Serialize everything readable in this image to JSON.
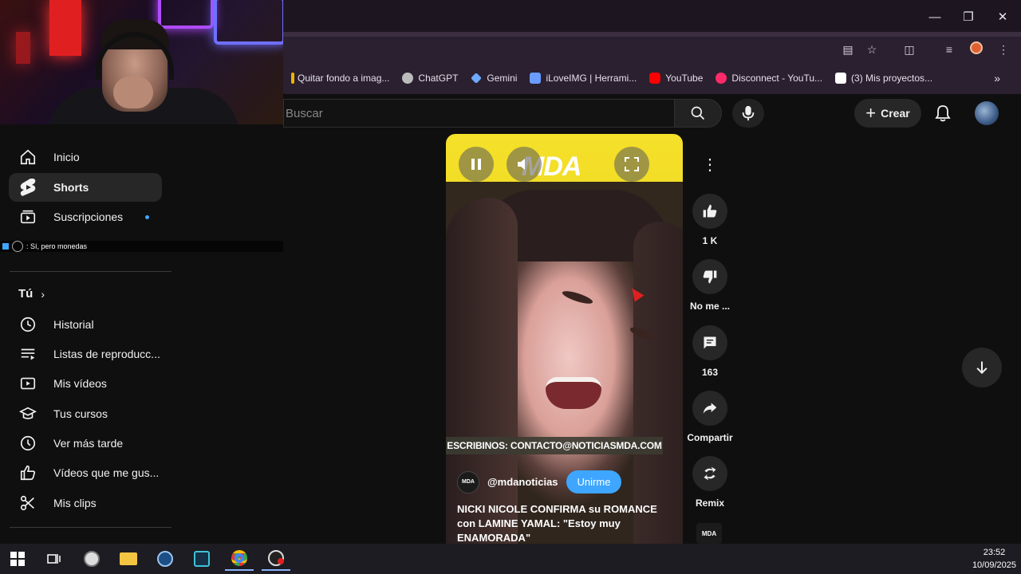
{
  "browser": {
    "bookmarks": [
      {
        "label": "Quitar fondo a imag...",
        "color": "#f0b400"
      },
      {
        "label": "ChatGPT",
        "color": "#bbbbbb"
      },
      {
        "label": "Gemini",
        "color": "#6fa8ff"
      },
      {
        "label": "iLoveIMG | Herrami...",
        "color": "#6a9cff"
      },
      {
        "label": "YouTube",
        "color": "#ff0000"
      },
      {
        "label": "Disconnect - YouTu...",
        "color": "#ff2a6a"
      },
      {
        "label": "(3)  Mis proyectos...",
        "color": "#ffffff"
      }
    ]
  },
  "header": {
    "search_placeholder": "Buscar",
    "create_label": "Crear"
  },
  "chat_overlay": {
    "text": ": Sí, pero monedas"
  },
  "sidebar": {
    "top": [
      {
        "label": "Inicio",
        "icon": "home-icon"
      },
      {
        "label": "Shorts",
        "icon": "shorts-icon",
        "active": true
      },
      {
        "label": "Suscripciones",
        "icon": "subscriptions-icon",
        "dot": true
      }
    ],
    "you_label": "Tú",
    "you_items": [
      {
        "label": "Historial",
        "icon": "history-icon"
      },
      {
        "label": "Listas de reproducc...",
        "icon": "playlists-icon"
      },
      {
        "label": "Mis vídeos",
        "icon": "my-videos-icon"
      },
      {
        "label": "Tus cursos",
        "icon": "courses-icon"
      },
      {
        "label": "Ver más tarde",
        "icon": "watch-later-icon"
      },
      {
        "label": "Vídeos que me gus...",
        "icon": "liked-icon"
      },
      {
        "label": "Mis clips",
        "icon": "clips-icon"
      }
    ]
  },
  "short": {
    "brand_watermark": "MDA",
    "banner_text": "ESCRIBINOS: CONTACTO@NOTICIASMDA.COM",
    "channel_name": "@mdanoticias",
    "channel_logo_text": "MDA",
    "join_label": "Unirme",
    "caption": "NICKI NICOLE CONFIRMA su ROMANCE con LAMINE YAMAL: \"Estoy muy ENAMORADA\""
  },
  "actions": {
    "like_count": "1 K",
    "dislike_label": "No me ...",
    "comment_count": "163",
    "share_label": "Compartir",
    "remix_label": "Remix",
    "mini_logo_text": "MDA"
  },
  "taskbar": {
    "time": "23:52",
    "date": "10/09/2025"
  },
  "colors": {
    "background": "#0f0f0f",
    "accent_blue": "#3ea6ff",
    "short_yellow": "#f5e02a"
  }
}
